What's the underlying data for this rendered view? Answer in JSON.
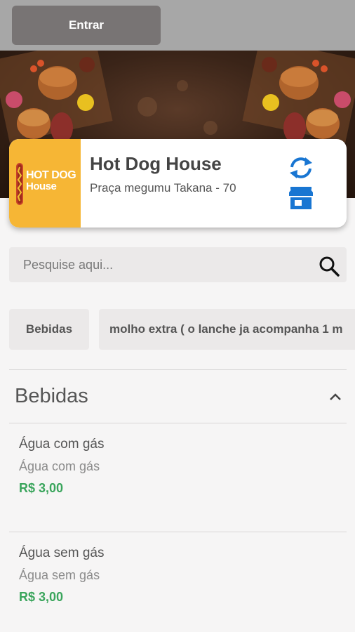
{
  "header": {
    "login_label": "Entrar"
  },
  "store": {
    "logo_line1": "HOT DOG",
    "logo_line2": "House",
    "name": "Hot Dog House",
    "address": "Praça megumu Takana - 70"
  },
  "search": {
    "placeholder": "Pesquise aqui..."
  },
  "categories": [
    {
      "label": "Bebidas"
    },
    {
      "label": "molho extra ( o lanche ja acompanha 1 m"
    }
  ],
  "section": {
    "title": "Bebidas"
  },
  "items": [
    {
      "name": "Água com gás",
      "description": "Água com gás",
      "price": "R$ 3,00"
    },
    {
      "name": "Água sem gás",
      "description": "Água sem gás",
      "price": "R$ 3,00"
    }
  ],
  "colors": {
    "accent_blue": "#1976d2",
    "price_green": "#3aa55c",
    "logo_yellow": "#f6b635"
  }
}
